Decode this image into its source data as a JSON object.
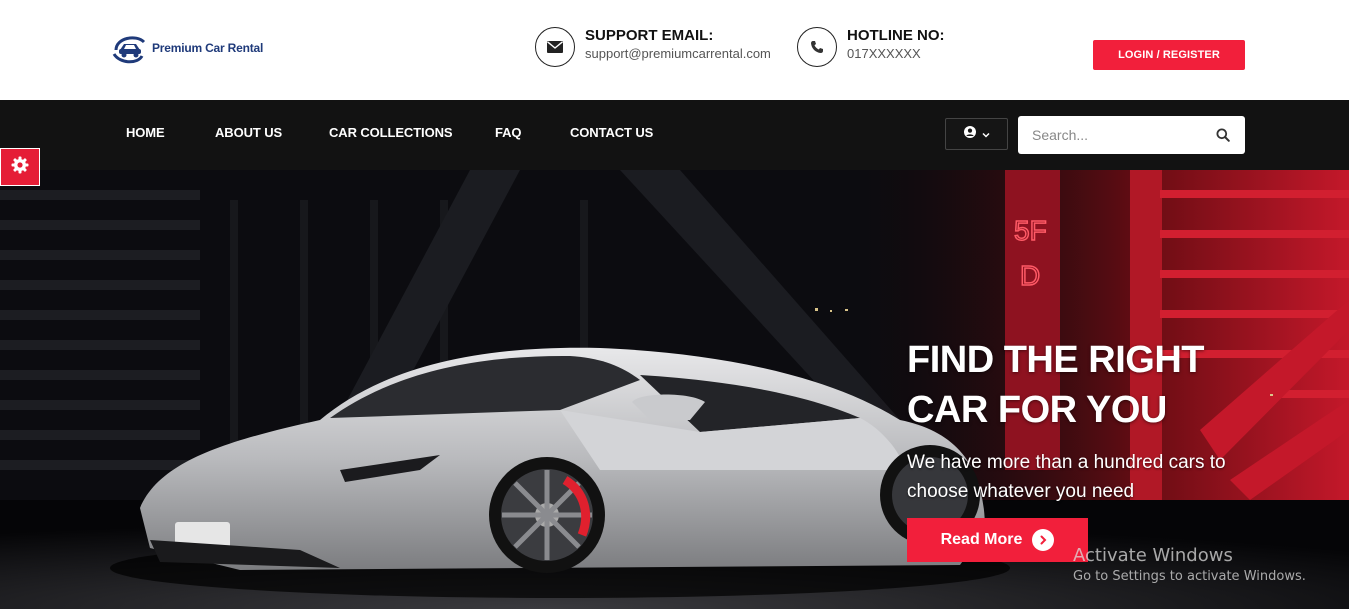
{
  "brand": {
    "name": "Premium Car Rental"
  },
  "contact": {
    "email_label": "SUPPORT EMAIL:",
    "email_value": "support@premiumcarrental.com",
    "hotline_label": "HOTLINE NO:",
    "hotline_value": "017XXXXXX"
  },
  "header": {
    "login_label": "LOGIN / REGISTER"
  },
  "nav": {
    "items": [
      {
        "label": "HOME"
      },
      {
        "label": "ABOUT US"
      },
      {
        "label": "CAR COLLECTIONS"
      },
      {
        "label": "FAQ"
      },
      {
        "label": "CONTACT US"
      }
    ]
  },
  "search": {
    "placeholder": "Search..."
  },
  "hero": {
    "title": "FIND THE RIGHT\nCAR FOR YOU",
    "subtitle": "We have more than a hundred cars to choose whatever you need",
    "button_label": "Read More",
    "sign_text_1": "5F",
    "sign_text_2": "D"
  },
  "system": {
    "watermark_title": "Activate Windows",
    "watermark_subtitle": "Go to Settings to activate Windows."
  },
  "colors": {
    "accent": "#f21f3b",
    "nav_bg": "#121212",
    "brand_blue": "#1f3a7a"
  },
  "icons": [
    "logo-mark-icon",
    "envelope-icon",
    "phone-icon",
    "user-icon",
    "chevron-down-icon",
    "search-icon",
    "gear-icon",
    "arrow-right-icon"
  ]
}
